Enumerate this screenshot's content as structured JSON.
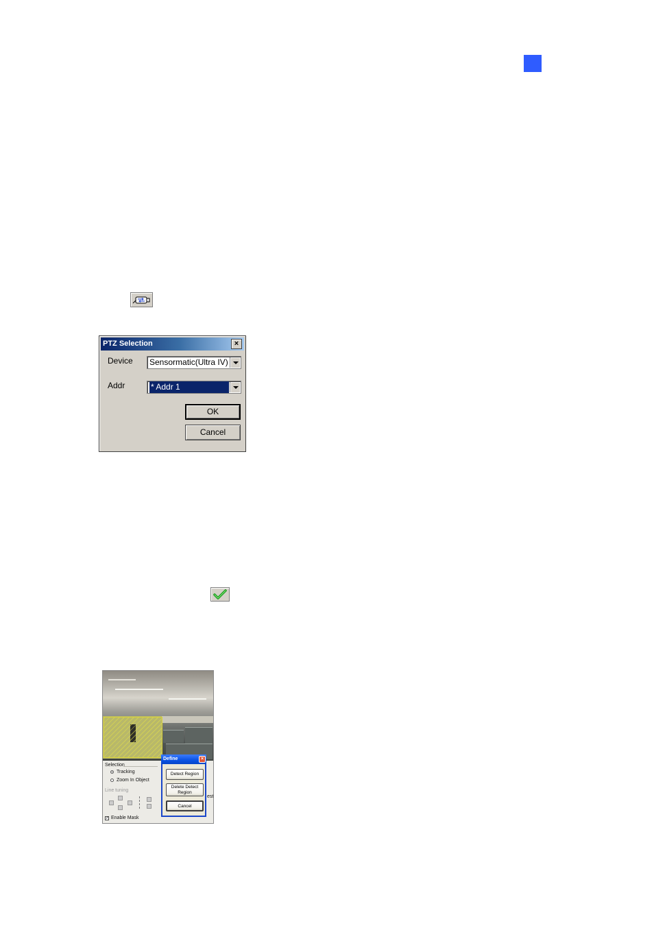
{
  "ptz_dialog": {
    "title": "PTZ Selection",
    "close_glyph": "×",
    "device_label": "Device",
    "device_value": "Sensormatic(Ultra IV)",
    "addr_label": "Addr",
    "addr_value": "* Addr 1",
    "ok_label": "OK",
    "cancel_label": "Cancel"
  },
  "icons": {
    "ptz_icon": "ptz-camera-icon",
    "check_icon": "green-checkmark-icon",
    "page_marker_color": "#2f5cff"
  },
  "tracker": {
    "selection_label": "Selection",
    "tracking_label": "Tracking",
    "zoom_label": "Zoom In Object",
    "line_tuning_label": "Line tuning",
    "enable_mask_label": "Enable Mask",
    "partial_label": "est",
    "define_dialog": {
      "title": "Define",
      "detect_region": "Detect Region",
      "delete_detect_region_line1": "Delete Detect",
      "delete_detect_region_line2": "Region",
      "cancel": "Cancel"
    }
  }
}
